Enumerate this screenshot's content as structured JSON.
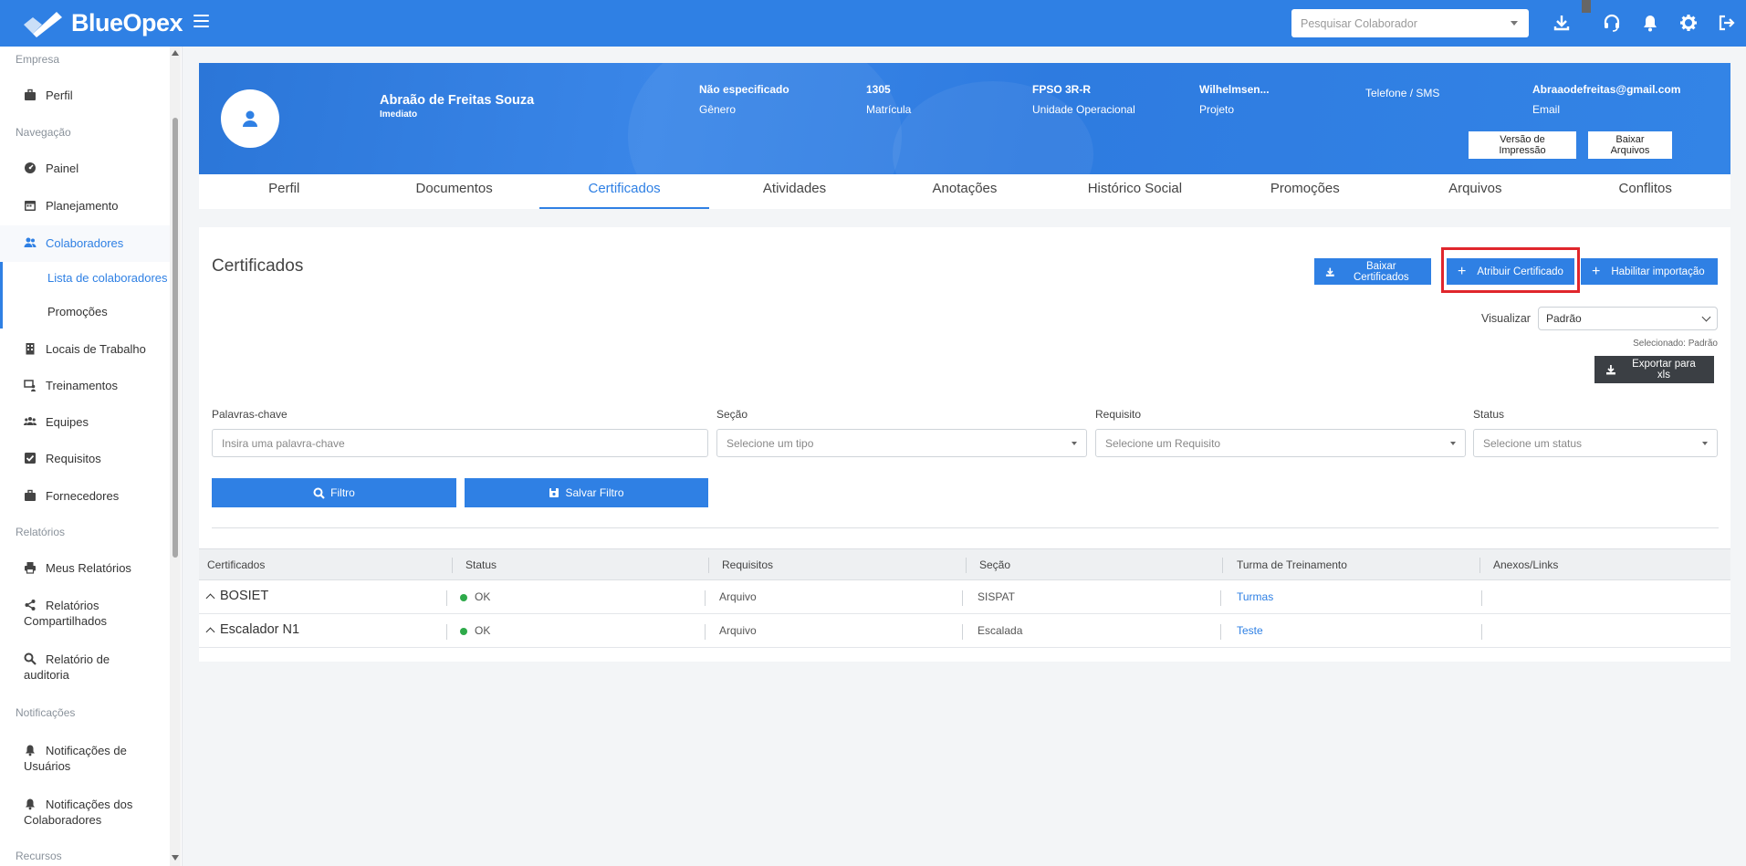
{
  "app": {
    "brand": "BlueOpex"
  },
  "topbar": {
    "search_placeholder": "Pesquisar Colaborador",
    "icons": [
      "download-icon",
      "headset-icon",
      "bell-icon",
      "gear-icon",
      "logout-icon"
    ]
  },
  "sidebar": {
    "sections": {
      "empresa": "Empresa",
      "navegacao": "Navegação",
      "relatorios": "Relatórios",
      "notificacoes": "Notificações",
      "recursos": "Recursos"
    },
    "items": {
      "perfil": "Perfil",
      "painel": "Painel",
      "planejamento": "Planejamento",
      "colaboradores": "Colaboradores",
      "lista": "Lista de colaboradores",
      "promocoes": "Promoções",
      "locais": "Locais de Trabalho",
      "treinamentos": "Treinamentos",
      "equipes": "Equipes",
      "requisitos": "Requisitos",
      "fornecedores": "Fornecedores",
      "meus_relatorios": "Meus Relatórios",
      "relatorios_compartilhados_1": "Relatórios",
      "relatorios_compartilhados_2": "Compartilhados",
      "auditoria_1": "Relatório de",
      "auditoria_2": "auditoria",
      "notif_usuarios_1": "Notificações de",
      "notif_usuarios_2": "Usuários",
      "notif_colab_1": "Notificações dos",
      "notif_colab_2": "Colaboradores"
    }
  },
  "profile": {
    "name": "Abraão de Freitas Souza",
    "role": "Imediato",
    "genero_value": "Não especificado",
    "genero_label": "Gênero",
    "matricula_value": "1305",
    "matricula_label": "Matrícula",
    "unidade_value": "FPSO 3R-R",
    "unidade_label": "Unidade Operacional",
    "projeto_value": "Wilhelmsen...",
    "projeto_label": "Projeto",
    "telefone_label": "Telefone / SMS",
    "email_value": "Abraaodefreitas@gmail.com",
    "email_label": "Email",
    "btn_impressao": "Versão de Impressão",
    "btn_baixar": "Baixar Arquivos"
  },
  "tabs": [
    "Perfil",
    "Documentos",
    "Certificados",
    "Atividades",
    "Anotações",
    "Histórico Social",
    "Promoções",
    "Arquivos",
    "Conflitos"
  ],
  "active_tab": "Certificados",
  "certificados": {
    "title": "Certificados",
    "btn_baixar": "Baixar Certificados",
    "btn_atribuir": "Atribuir Certificado",
    "btn_habilitar": "Habilitar importação",
    "visualizar_label": "Visualizar",
    "visualizar_value": "Padrão",
    "selecionado_note": "Selecionado: Padrão",
    "btn_exportar": "Exportar para xls",
    "filters": {
      "palavras_label": "Palavras-chave",
      "palavras_placeholder": "Insira uma palavra-chave",
      "secao_label": "Seção",
      "secao_placeholder": "Selecione um tipo",
      "requisito_label": "Requisito",
      "requisito_placeholder": "Selecione um Requisito",
      "status_label": "Status",
      "status_placeholder": "Selecione um status",
      "btn_filtro": "Filtro",
      "btn_salvar": "Salvar Filtro"
    },
    "table": {
      "headers": [
        "Certificados",
        "Status",
        "Requisitos",
        "Seção",
        "Turma de Treinamento",
        "Anexos/Links"
      ],
      "rows": [
        {
          "name": "BOSIET",
          "status": "OK",
          "requisito": "Arquivo",
          "secao": "SISPAT",
          "turma": "Turmas",
          "anexos": ""
        },
        {
          "name": "Escalador N1",
          "status": "OK",
          "requisito": "Arquivo",
          "secao": "Escalada",
          "turma": "Teste",
          "anexos": ""
        }
      ]
    }
  },
  "colors": {
    "primary": "#2f80e4",
    "dark_button": "#3b3f44",
    "highlight": "#e0262c",
    "status_ok": "#2eaa4a"
  }
}
